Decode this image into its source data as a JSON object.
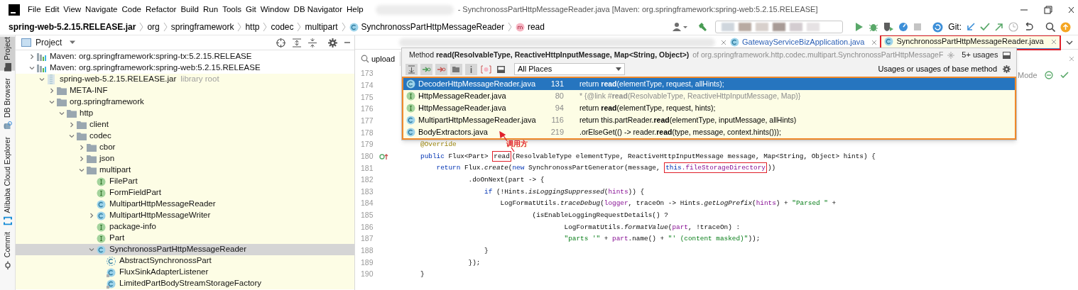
{
  "menu_bar": {
    "items": [
      "File",
      "Edit",
      "View",
      "Navigate",
      "Code",
      "Refactor",
      "Build",
      "Run",
      "Tools",
      "Git",
      "Window",
      "DB Navigator",
      "Help"
    ]
  },
  "window": {
    "title": "- SynchronossPartHttpMessageReader.java [Maven: org.springframework:spring-web:5.2.15.RELEASE]"
  },
  "breadcrumbs": [
    {
      "text": "spring-web-5.2.15.RELEASE.jar",
      "kind": "archive"
    },
    {
      "text": "org",
      "kind": "package"
    },
    {
      "text": "springframework",
      "kind": "package"
    },
    {
      "text": "http",
      "kind": "package"
    },
    {
      "text": "codec",
      "kind": "package"
    },
    {
      "text": "multipart",
      "kind": "package"
    },
    {
      "text": "SynchronossPartHttpMessageReader",
      "kind": "class"
    },
    {
      "text": "read",
      "kind": "method"
    }
  ],
  "toolbar": {
    "vcs_label": "Git:"
  },
  "tool_window_stripe": [
    {
      "label": "Project",
      "selected": true
    },
    {
      "label": "DB Browser",
      "selected": false
    },
    {
      "label": "Alibaba Cloud Explorer",
      "selected": false
    },
    {
      "label": "Commit",
      "selected": false
    }
  ],
  "project_panel": {
    "title": "Project",
    "tree": [
      {
        "label": "Maven: org.springframework:spring-tx:5.2.15.RELEASE",
        "kind": "library",
        "expanded": false,
        "selected": false
      },
      {
        "label": "Maven: org.springframework:spring-web:5.2.15.RELEASE",
        "kind": "library",
        "expanded": true,
        "selected": false,
        "children": [
          {
            "label": "spring-web-5.2.15.RELEASE.jar",
            "hint": "library root",
            "kind": "jar",
            "expanded": true,
            "selected": false,
            "scope_highlight": true,
            "children": [
              {
                "label": "META-INF",
                "kind": "folder",
                "expanded": false,
                "selected": false
              },
              {
                "label": "org.springframework",
                "kind": "folder",
                "expanded": true,
                "selected": false,
                "children": [
                  {
                    "label": "http",
                    "kind": "folder",
                    "expanded": true,
                    "selected": false,
                    "children": [
                      {
                        "label": "client",
                        "kind": "folder",
                        "expanded": false,
                        "selected": false
                      },
                      {
                        "label": "codec",
                        "kind": "folder",
                        "expanded": true,
                        "selected": false,
                        "children": [
                          {
                            "label": "cbor",
                            "kind": "folder",
                            "expanded": false,
                            "selected": false
                          },
                          {
                            "label": "json",
                            "kind": "folder",
                            "expanded": false,
                            "selected": false
                          },
                          {
                            "label": "multipart",
                            "kind": "folder",
                            "expanded": true,
                            "selected": false,
                            "children": [
                              {
                                "label": "FilePart",
                                "kind": "interface",
                                "selected": false
                              },
                              {
                                "label": "FormFieldPart",
                                "kind": "interface",
                                "selected": false
                              },
                              {
                                "label": "MultipartHttpMessageReader",
                                "kind": "class",
                                "selected": false
                              },
                              {
                                "label": "MultipartHttpMessageWriter",
                                "kind": "class",
                                "expanded": false,
                                "selected": false
                              },
                              {
                                "label": "package-info",
                                "kind": "interface",
                                "selected": false
                              },
                              {
                                "label": "Part",
                                "kind": "interface",
                                "selected": false
                              },
                              {
                                "label": "SynchronossPartHttpMessageReader",
                                "kind": "class",
                                "expanded": true,
                                "selected": true,
                                "children": [
                                  {
                                    "label": "AbstractSynchronossPart",
                                    "kind": "abstract_class",
                                    "selected": false
                                  },
                                  {
                                    "label": "FluxSinkAdapterListener",
                                    "kind": "inner_class",
                                    "selected": false
                                  },
                                  {
                                    "label": "LimitedPartBodyStreamStorageFactory",
                                    "kind": "inner_class",
                                    "selected": false
                                  }
                                ]
                              }
                            ]
                          }
                        ]
                      }
                    ]
                  }
                ]
              }
            ]
          }
        ]
      }
    ]
  },
  "editor_tabs": [
    {
      "label": "GatewayServiceBizApplication.java",
      "selected": false,
      "annotated": false
    },
    {
      "label": "SynchronossPartHttpMessageReader.java",
      "selected": true,
      "annotated": true
    }
  ],
  "editor": {
    "search": {
      "value": "upload"
    },
    "reader_mode_label": "Mode",
    "lines": [
      {
        "number": "173"
      },
      {
        "number": "174"
      },
      {
        "number": "175"
      },
      {
        "number": "176"
      },
      {
        "number": "177"
      },
      {
        "number": "178"
      },
      {
        "number": "179",
        "tokens": [
          {
            "text": "@Override",
            "kind": "annotation"
          }
        ]
      },
      {
        "number": "180",
        "overrides": true,
        "tokens": [
          {
            "text": "public ",
            "kind": "keyword"
          },
          {
            "text": "Flux<Part> ",
            "kind": "plain"
          },
          {
            "kind": "group",
            "boxed": true,
            "tokens": [
              {
                "text": "read",
                "kind": "plain"
              }
            ]
          },
          {
            "text": "(ResolvableType elementType, ReactiveHttpInputMessage message, Map<String, Object> hints) {",
            "kind": "plain"
          }
        ]
      },
      {
        "number": "181",
        "tokens": [
          {
            "text": "    return ",
            "kind": "keyword"
          },
          {
            "text": "Flux.",
            "kind": "plain"
          },
          {
            "text": "create",
            "kind": "method_call"
          },
          {
            "text": "(",
            "kind": "plain"
          },
          {
            "text": "new ",
            "kind": "keyword"
          },
          {
            "text": "SynchronossPartGenerator(message, ",
            "kind": "plain"
          },
          {
            "kind": "group",
            "boxed": true,
            "tokens": [
              {
                "text": "this",
                "kind": "keyword"
              },
              {
                "text": ".fileStorageDirectory",
                "kind": "field"
              }
            ]
          },
          {
            "text": "))",
            "kind": "plain"
          }
        ]
      },
      {
        "number": "182",
        "tokens": [
          {
            "text": "            .doOnNext(part -> {",
            "kind": "plain"
          }
        ]
      },
      {
        "number": "183",
        "tokens": [
          {
            "text": "                if ",
            "kind": "keyword"
          },
          {
            "text": "(!Hints.",
            "kind": "plain"
          },
          {
            "text": "isLoggingSuppressed",
            "kind": "method_call"
          },
          {
            "text": "(",
            "kind": "plain"
          },
          {
            "text": "hints",
            "kind": "field"
          },
          {
            "text": ")) {",
            "kind": "plain"
          }
        ]
      },
      {
        "number": "184",
        "tokens": [
          {
            "text": "                    LogFormatUtils.",
            "kind": "plain"
          },
          {
            "text": "traceDebug",
            "kind": "method_call"
          },
          {
            "text": "(",
            "kind": "plain"
          },
          {
            "text": "logger",
            "kind": "field"
          },
          {
            "text": ", traceOn -> Hints.",
            "kind": "plain"
          },
          {
            "text": "getLogPrefix",
            "kind": "method_call"
          },
          {
            "text": "(",
            "kind": "plain"
          },
          {
            "text": "hints",
            "kind": "field"
          },
          {
            "text": ") + ",
            "kind": "plain"
          },
          {
            "text": "\"Parsed \"",
            "kind": "string"
          },
          {
            "text": " +",
            "kind": "plain"
          }
        ]
      },
      {
        "number": "185",
        "tokens": [
          {
            "text": "                            (isEnableLoggingRequestDetails() ?",
            "kind": "plain"
          }
        ]
      },
      {
        "number": "186",
        "tokens": [
          {
            "text": "                                    LogFormatUtils.",
            "kind": "plain"
          },
          {
            "text": "formatValue",
            "kind": "method_call"
          },
          {
            "text": "(",
            "kind": "plain"
          },
          {
            "text": "part",
            "kind": "field"
          },
          {
            "text": ", !traceOn) :",
            "kind": "plain"
          }
        ]
      },
      {
        "number": "187",
        "tokens": [
          {
            "text": "                                    \"parts '\"",
            "kind": "string"
          },
          {
            "text": " + ",
            "kind": "plain"
          },
          {
            "text": "part",
            "kind": "field"
          },
          {
            "text": ".name() + ",
            "kind": "plain"
          },
          {
            "text": "\"' (content masked)\"",
            "kind": "string"
          },
          {
            "text": "));",
            "kind": "plain"
          }
        ]
      },
      {
        "number": "188",
        "tokens": [
          {
            "text": "                }",
            "kind": "plain"
          }
        ]
      },
      {
        "number": "189",
        "tokens": [
          {
            "text": "            });",
            "kind": "plain"
          }
        ]
      },
      {
        "number": "190",
        "tokens": [
          {
            "text": "}",
            "kind": "plain"
          }
        ]
      }
    ]
  },
  "usages_popup": {
    "title": "Method **read(ResolvableType, ReactiveHttpInputMessage, Map<String, Object>)**",
    "location": "of org.springframework.http.codec.multipart.SynchronossPartHttpMessageF",
    "count": "5+ usages",
    "scope": "All Places",
    "filter_label": "Usages or usages of base method",
    "results": [
      {
        "file": "DecoderHttpMessageReader.java",
        "kind": "class",
        "line": "131",
        "snippet": "return **read**(elementType, request, allHints);",
        "comment": false,
        "selected": true
      },
      {
        "file": "HttpMessageReader.java",
        "kind": "interface",
        "line": "80",
        "snippet": "* {@link #**read**(ResolvableType, ReactiveHttpInputMessage, Map)}",
        "comment": true,
        "selected": false
      },
      {
        "file": "HttpMessageReader.java",
        "kind": "interface",
        "line": "94",
        "snippet": "return **read**(elementType, request, hints);",
        "comment": false,
        "selected": false
      },
      {
        "file": "MultipartHttpMessageReader.java",
        "kind": "class",
        "line": "116",
        "snippet": "return this.partReader.**read**(elementType, inputMessage, allHints)",
        "comment": false,
        "selected": false
      },
      {
        "file": "BodyExtractors.java",
        "kind": "class",
        "line": "219",
        "snippet": ".orElseGet(() -> reader.**read**(type, message, context.hints()));",
        "comment": false,
        "selected": false
      }
    ]
  },
  "annotation": {
    "label": "调用方"
  }
}
